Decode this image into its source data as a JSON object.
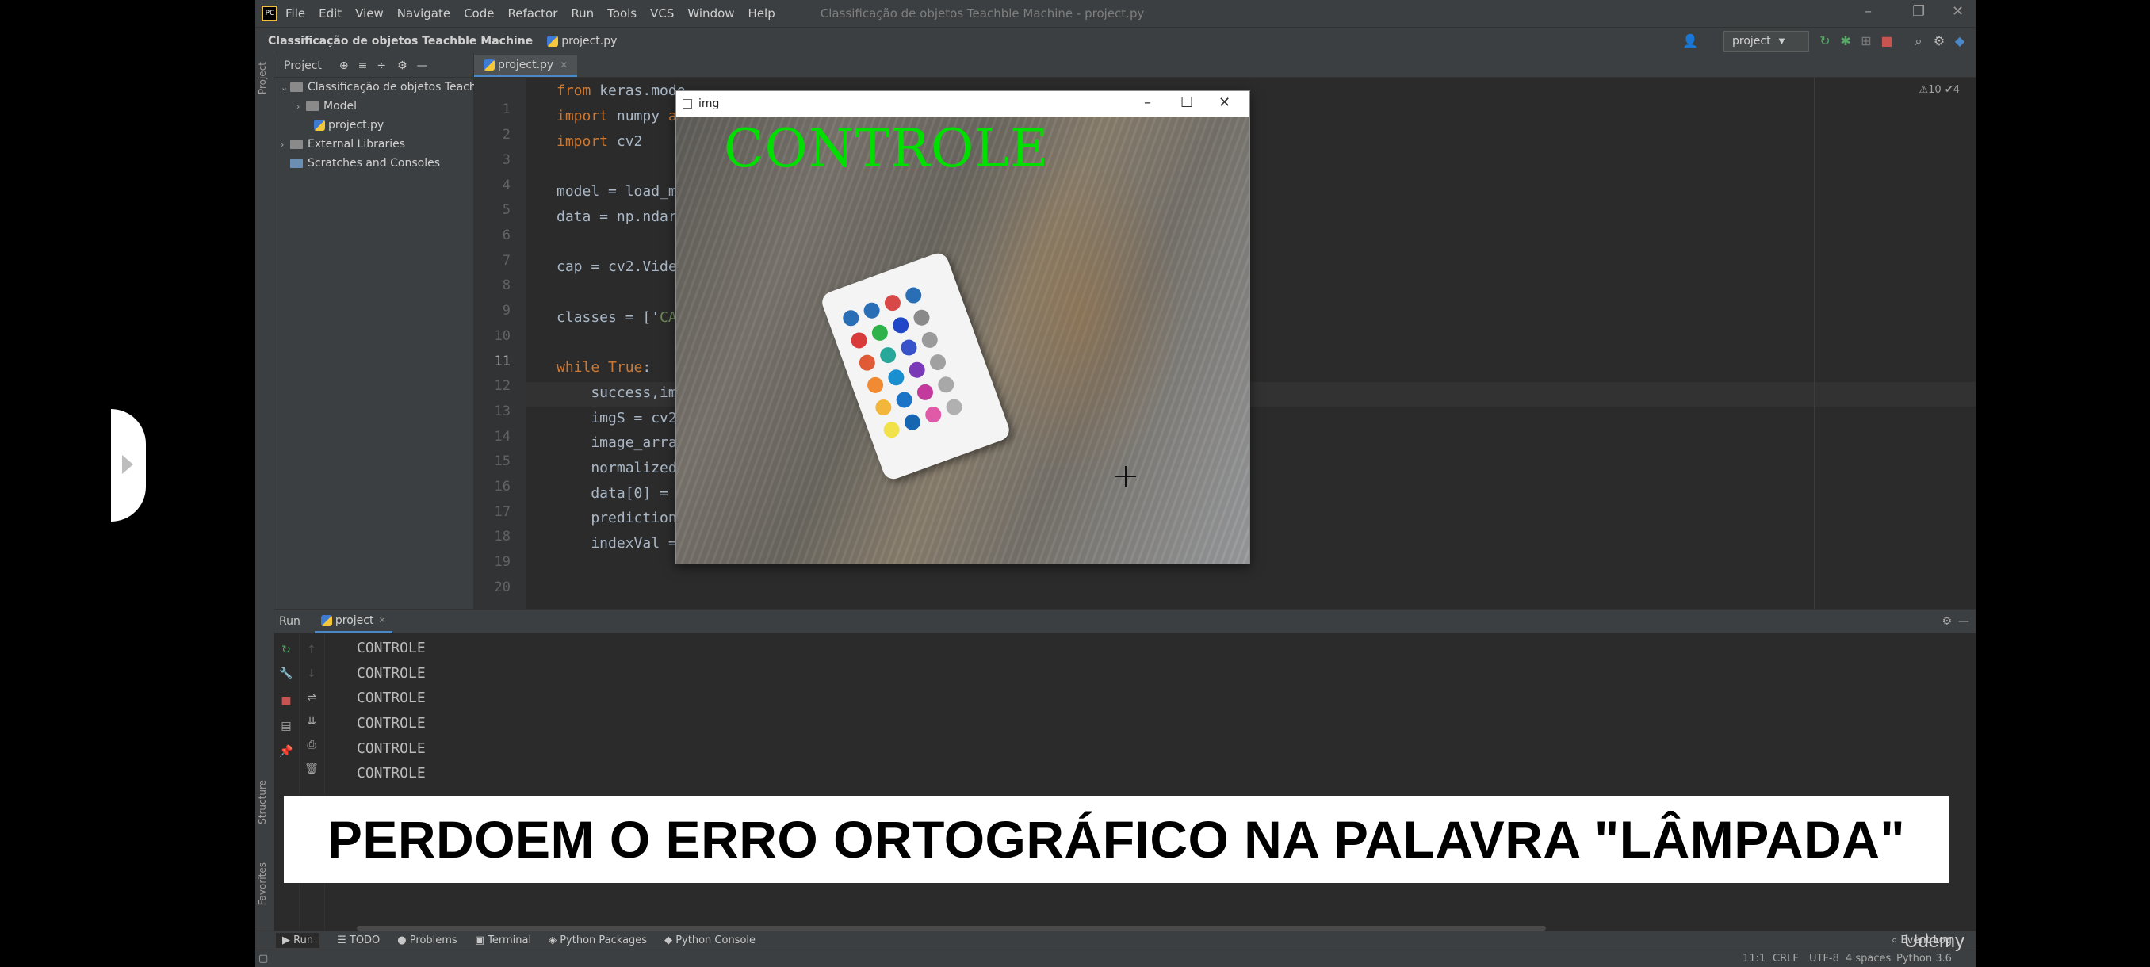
{
  "menu": {
    "items": [
      "File",
      "Edit",
      "View",
      "Navigate",
      "Code",
      "Refactor",
      "Run",
      "Tools",
      "VCS",
      "Window",
      "Help"
    ],
    "title": "Classificação de objetos Teachble Machine - project.py"
  },
  "navbar": {
    "breadcrumb_project": "Classificação de objetos Teachble Machine",
    "breadcrumb_file": "project.py",
    "run_config": "project"
  },
  "project_panel": {
    "toolbar_label": "Project",
    "tree": [
      "Classificação de objetos Teachble",
      "Model",
      "project.py",
      "External Libraries",
      "Scratches and Consoles"
    ]
  },
  "sidebar_tabs": {
    "project": "Project",
    "structure": "Structure",
    "favorites": "Favorites"
  },
  "editor": {
    "tab": "project.py",
    "inspection": "⚠10 ✔4",
    "lines": [
      "1",
      "2",
      "3",
      "4",
      "5",
      "6",
      "7",
      "8",
      "9",
      "10",
      "11",
      "12",
      "13",
      "14",
      "15",
      "16",
      "17",
      "18",
      "19",
      "20"
    ],
    "code": {
      "l1_kw": "from",
      "l1_rest": " keras.mode",
      "l2_kw": "import",
      "l2_rest": " numpy ",
      "l2_kw2": "as",
      "l3_kw": "import",
      "l3_rest": " cv2",
      "l5": "model = load_mo",
      "l6": "data = np.ndarr",
      "l8": "cap = cv2.Video",
      "l10_a": "classes = ['",
      "l10_str": "CAL",
      "l12_kw": "while",
      "l12_kw2": " True",
      "l12_rest": ":",
      "l13": "    success,img",
      "l14": "    imgS = cv2.",
      "l15": "    image_array",
      "l16": "    normalized_",
      "l17": "    data[0] = n",
      "l18": "    prediction ",
      "l19": "    indexVal = "
    }
  },
  "image_window": {
    "title": "img",
    "overlay_label": "CONTROLE"
  },
  "run_panel": {
    "label": "Run",
    "tab": "project",
    "output": [
      "CONTROLE",
      "CONTROLE",
      "CONTROLE",
      "CONTROLE",
      "CONTROLE",
      "CONTROLE"
    ]
  },
  "bottom_tabs": [
    "Run",
    "TODO",
    "Problems",
    "Terminal",
    "Python Packages",
    "Python Console"
  ],
  "statusbar": {
    "position": "11:1",
    "line_sep": "CRLF",
    "encoding": "UTF-8",
    "indent": "4 spaces",
    "interpreter": "Python 3.6",
    "event_log": "Event Log"
  },
  "subtitle": "PERDOEM O ERRO ORTOGRÁFICO NA PALAVRA \"LÂMPADA\"",
  "watermark": "Udemy"
}
